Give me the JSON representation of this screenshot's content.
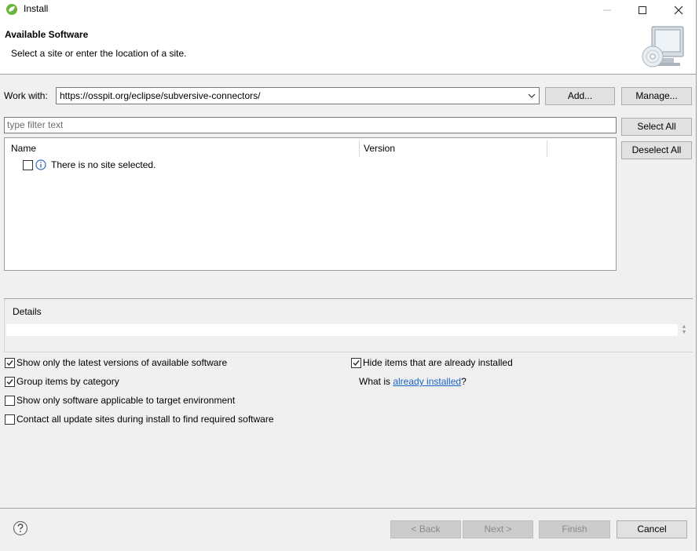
{
  "window": {
    "title": "Install",
    "minimize_icon": "minimize-icon",
    "maximize_icon": "maximize-icon",
    "close_icon": "close-icon"
  },
  "banner": {
    "title": "Available Software",
    "description": "Select a site or enter the location of a site.",
    "image_icon": "computer-cd-icon"
  },
  "work_with": {
    "label": "Work with:",
    "value": "https://osspit.org/eclipse/subversive-connectors/",
    "add_label": "Add...",
    "manage_label": "Manage..."
  },
  "filter": {
    "placeholder": "type filter text",
    "select_all_label": "Select All",
    "deselect_all_label": "Deselect All"
  },
  "table": {
    "columns": [
      "Name",
      "Version"
    ],
    "rows": [
      {
        "checked": false,
        "icon": "info-icon",
        "text": "There is no site selected."
      }
    ]
  },
  "details": {
    "label": "Details"
  },
  "options": {
    "latest_versions": {
      "label": "Show only the latest versions of available software",
      "checked": true
    },
    "group_by_category": {
      "label": "Group items by category",
      "checked": true
    },
    "target_env": {
      "label": "Show only software applicable to target environment",
      "checked": false
    },
    "contact_sites": {
      "label": "Contact all update sites during install to find required software",
      "checked": false
    },
    "hide_installed": {
      "label": "Hide items that are already installed",
      "checked": true
    },
    "what_is_prefix": "What is ",
    "already_installed_link": "already installed",
    "what_is_suffix": "?"
  },
  "footer": {
    "help_icon": "help-icon",
    "back_label": "< Back",
    "next_label": "Next >",
    "finish_label": "Finish",
    "cancel_label": "Cancel"
  },
  "colors": {
    "background": "#f0f0f0",
    "link": "#1a63c7",
    "app_icon_green": "#6db33f"
  }
}
